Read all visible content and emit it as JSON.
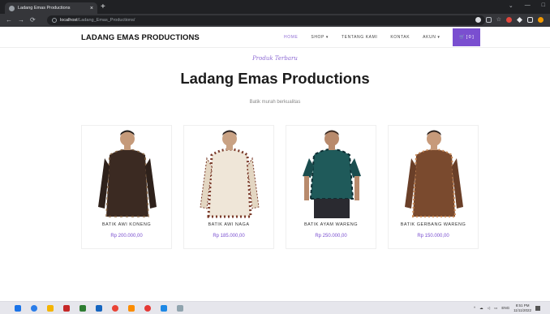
{
  "browser": {
    "tab_title": "Ladang Emas Productions",
    "tab_close": "×",
    "new_tab": "+",
    "window_controls": [
      "⌄",
      "—",
      "□"
    ],
    "url_host": "localhost",
    "url_path": "/Ladang_Emas_Productions/"
  },
  "site": {
    "brand": "LADANG EMAS PRODUCTIONS",
    "menu": [
      "HOME",
      "SHOP ▾",
      "TENTANG KAMI",
      "KONTAK",
      "AKUN ▾"
    ],
    "cart_label": "🛒 [ 0 ]",
    "colors": {
      "accent": "#7a4fd0",
      "kicker": "#8e6bd4"
    }
  },
  "hero": {
    "kicker": "Produk Terbaru",
    "title": "Ladang Emas Productions",
    "subtitle": "Batik murah berkualitas"
  },
  "products": [
    {
      "name": "BATIK AWI KONENG",
      "price": "Rp 200.000,00"
    },
    {
      "name": "BATIK AWI NAGA",
      "price": "Rp 185.000,00"
    },
    {
      "name": "BATIK AYAM WARENG",
      "price": "Rp 250.000,00"
    },
    {
      "name": "BATIK GERBANG WARENG",
      "price": "Rp 150.000,00"
    }
  ],
  "taskbar": {
    "lang": "ENG",
    "time": "8:51 PM",
    "date": "11/11/2022"
  }
}
